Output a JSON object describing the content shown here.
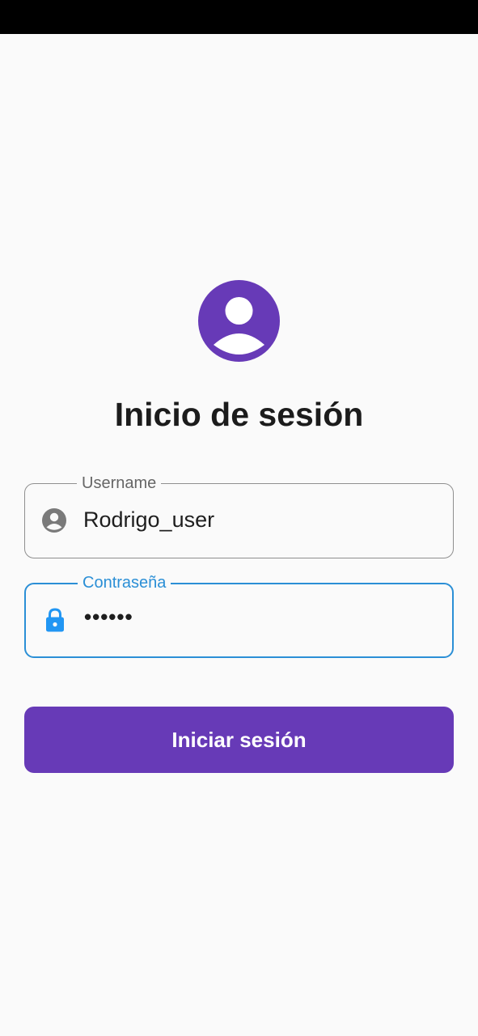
{
  "colors": {
    "accent": "#673ab7",
    "focus": "#2b8fd6",
    "background": "#fafafa",
    "status_bar": "#000000"
  },
  "header": {
    "avatar_icon": "account-circle-icon",
    "title": "Inicio de sesión"
  },
  "form": {
    "username": {
      "label": "Username",
      "value": "Rodrigo_user",
      "icon": "account-circle-icon"
    },
    "password": {
      "label": "Contraseña",
      "value": "••••••",
      "icon": "lock-icon",
      "focused": true
    },
    "submit_label": "Iniciar sesión"
  }
}
